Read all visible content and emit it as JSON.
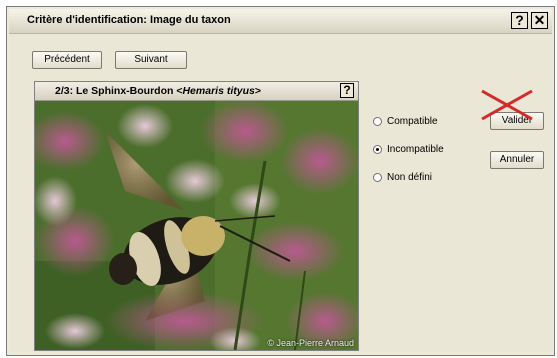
{
  "window": {
    "title": "Critère d'identification: Image du taxon",
    "help_label": "?",
    "close_label": "✕"
  },
  "nav": {
    "previous_label": "Précédent",
    "next_label": "Suivant"
  },
  "panel": {
    "title_prefix": "2/3: Le Sphinx-Bourdon <",
    "title_species": "Hemaris tityus",
    "title_suffix": ">",
    "help_label": "?",
    "photo_credit": "© Jean-Pierre Arnaud"
  },
  "options": [
    {
      "label": "Compatible",
      "selected": false
    },
    {
      "label": "Incompatible",
      "selected": true
    },
    {
      "label": "Non défini",
      "selected": false
    }
  ],
  "actions": {
    "validate_label": "Valider",
    "cancel_label": "Annuler"
  },
  "colors": {
    "cross": "#d42a2a",
    "photo_bg": "#4a6f2a"
  }
}
